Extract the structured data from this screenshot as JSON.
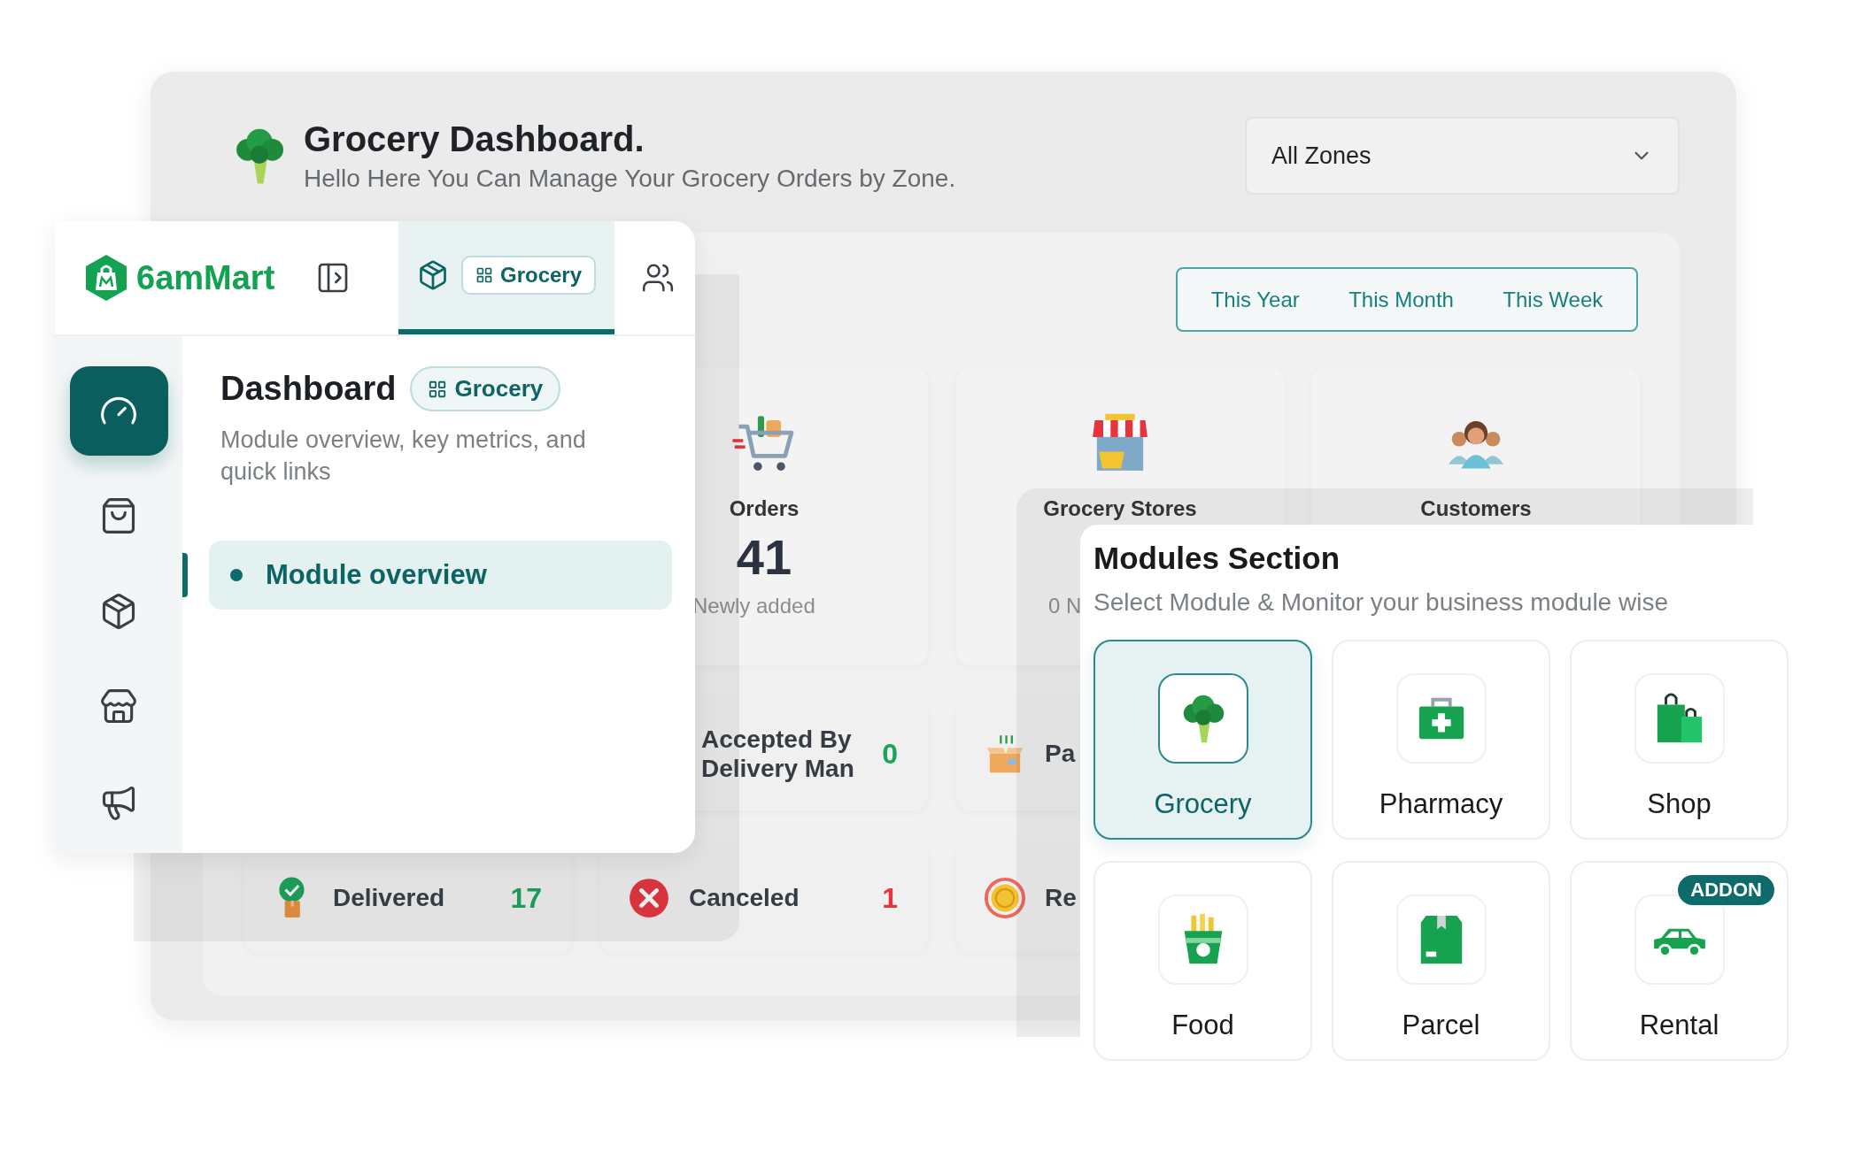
{
  "dashboard": {
    "title": "Grocery Dashboard.",
    "subtitle": "Hello Here You Can Manage Your Grocery Orders by Zone.",
    "zone_select": {
      "value": "All Zones"
    },
    "period_tabs": [
      {
        "label": "This Year"
      },
      {
        "label": "This Month"
      },
      {
        "label": "This Week"
      }
    ],
    "stats": [
      {
        "kind": "orders",
        "label": "Orders",
        "value": "41",
        "note": "Newly added"
      },
      {
        "kind": "stores",
        "label": "Grocery Stores",
        "note": "0 N"
      },
      {
        "kind": "customers",
        "label": "Customers"
      }
    ],
    "status_rows": [
      [
        {
          "kind": "accepted",
          "label": "Accepted By Delivery Man",
          "count": "0",
          "color": "#19a35b"
        },
        {
          "kind": "packaged",
          "label": "Pa"
        }
      ],
      [
        {
          "kind": "delivered",
          "label": "Delivered",
          "count": "17",
          "color": "#19a35b"
        },
        {
          "kind": "canceled",
          "label": "Canceled",
          "count": "1",
          "color": "#e5343c"
        },
        {
          "kind": "refund",
          "label": "Re"
        }
      ]
    ]
  },
  "sidebar": {
    "brand": "6amMart",
    "module_tab": {
      "label": "Grocery"
    },
    "rail": [
      {
        "kind": "dashboard",
        "selected": true
      },
      {
        "kind": "orders",
        "selected": false
      },
      {
        "kind": "items",
        "selected": false
      },
      {
        "kind": "stores",
        "selected": false
      },
      {
        "kind": "promotions",
        "selected": false
      }
    ],
    "page": {
      "title": "Dashboard",
      "badge": "Grocery",
      "description": "Module overview, key metrics, and quick links"
    },
    "menu": [
      {
        "label": "Module overview",
        "selected": true
      }
    ]
  },
  "modules": {
    "title": "Modules Section",
    "subtitle": "Select Module & Monitor your business module wise",
    "items": [
      {
        "kind": "grocery",
        "label": "Grocery",
        "selected": true
      },
      {
        "kind": "pharmacy",
        "label": "Pharmacy",
        "selected": false
      },
      {
        "kind": "shop",
        "label": "Shop",
        "selected": false
      },
      {
        "kind": "food",
        "label": "Food",
        "selected": false
      },
      {
        "kind": "parcel",
        "label": "Parcel",
        "selected": false
      },
      {
        "kind": "rental",
        "label": "Rental",
        "selected": false,
        "badge": "ADDON"
      }
    ]
  }
}
